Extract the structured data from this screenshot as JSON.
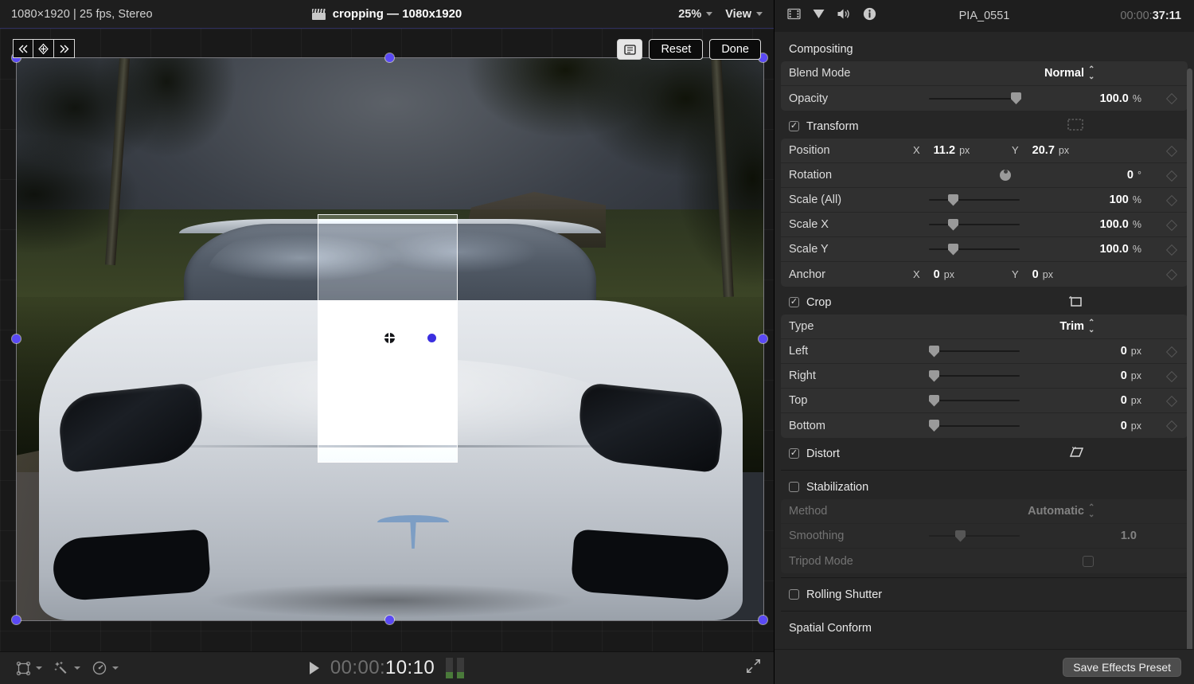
{
  "viewer": {
    "meta": "1080×1920 | 25 fps, Stereo",
    "title": "cropping — 1080x1920",
    "clapper_icon": "clapperboard-icon",
    "zoom": "25%",
    "view_label": "View",
    "overlay": {
      "prev_keyframe_icon": "previous-keyframe-icon",
      "add_keyframe_icon": "add-keyframe-icon",
      "next_keyframe_icon": "next-keyframe-icon",
      "crop_mode_icon": "crop-tool-icon",
      "reset_label": "Reset",
      "done_label": "Done"
    },
    "bottom": {
      "transform_icon": "transform-icon",
      "enhance_icon": "enhancements-icon",
      "retime_icon": "retime-icon",
      "play_icon": "play-icon",
      "timecode_dim": "00:00:",
      "timecode_lit": "10:10",
      "fullscreen_icon": "fullscreen-icon"
    }
  },
  "inspector": {
    "icons": [
      "video-icon",
      "filter-icon",
      "audio-icon",
      "info-icon"
    ],
    "clip_name": "PIA_0551",
    "timecode_dim": "00:00:",
    "timecode_lit": "37:11",
    "save_preset_label": "Save Effects Preset",
    "groups": [
      {
        "name": "Compositing",
        "checkbox": null,
        "icon": null,
        "rows": [
          {
            "label": "Blend Mode",
            "type": "popup",
            "value": "Normal",
            "keyframe": false
          },
          {
            "label": "Opacity",
            "type": "slider",
            "value": "100.0",
            "unit": "%",
            "slider_pct": 96,
            "keyframe": true
          }
        ]
      },
      {
        "name": "Transform",
        "checkbox": true,
        "icon": "transform-rect-icon",
        "rows": [
          {
            "label": "Position",
            "type": "xy",
            "x_axis": "X",
            "x_value": "11.2",
            "x_unit": "px",
            "y_axis": "Y",
            "y_value": "20.7",
            "y_unit": "px",
            "keyframe": true
          },
          {
            "label": "Rotation",
            "type": "dial",
            "value": "0",
            "unit": "°",
            "keyframe": true
          },
          {
            "label": "Scale (All)",
            "type": "slider",
            "value": "100",
            "unit": "%",
            "slider_pct": 26,
            "keyframe": true
          },
          {
            "label": "Scale X",
            "type": "slider",
            "value": "100.0",
            "unit": "%",
            "slider_pct": 26,
            "keyframe": true
          },
          {
            "label": "Scale Y",
            "type": "slider",
            "value": "100.0",
            "unit": "%",
            "slider_pct": 26,
            "keyframe": true
          },
          {
            "label": "Anchor",
            "type": "xy",
            "x_axis": "X",
            "x_value": "0",
            "x_unit": "px",
            "y_axis": "Y",
            "y_value": "0",
            "y_unit": "px",
            "keyframe": true
          }
        ]
      },
      {
        "name": "Crop",
        "checkbox": true,
        "icon": "crop-rect-icon",
        "rows": [
          {
            "label": "Type",
            "type": "popup",
            "value": "Trim",
            "keyframe": false
          },
          {
            "label": "Left",
            "type": "slider",
            "value": "0",
            "unit": "px",
            "slider_pct": 2,
            "keyframe": true
          },
          {
            "label": "Right",
            "type": "slider",
            "value": "0",
            "unit": "px",
            "slider_pct": 2,
            "keyframe": true
          },
          {
            "label": "Top",
            "type": "slider",
            "value": "0",
            "unit": "px",
            "slider_pct": 2,
            "keyframe": true
          },
          {
            "label": "Bottom",
            "type": "slider",
            "value": "0",
            "unit": "px",
            "slider_pct": 2,
            "keyframe": true
          }
        ]
      },
      {
        "name": "Distort",
        "checkbox": true,
        "icon": "distort-icon",
        "rows": []
      },
      {
        "name": "Stabilization",
        "checkbox": false,
        "icon": null,
        "disabled": true,
        "rows": [
          {
            "label": "Method",
            "type": "popup",
            "value": "Automatic",
            "keyframe": false
          },
          {
            "label": "Smoothing",
            "type": "slider",
            "value": "1.0",
            "unit": "",
            "slider_pct": 30,
            "keyframe": false
          },
          {
            "label": "Tripod Mode",
            "type": "checkbox",
            "value": "",
            "keyframe": false
          }
        ]
      },
      {
        "name": "Rolling Shutter",
        "checkbox": false,
        "icon": null,
        "rows": []
      },
      {
        "name": "Spatial Conform",
        "checkbox": null,
        "icon": null,
        "rows": []
      }
    ]
  },
  "colors": {
    "handle_blue": "#5a49f5",
    "panel_bg": "#262626",
    "row_bg": "#303030",
    "accent_button": "#4d4d4d"
  }
}
